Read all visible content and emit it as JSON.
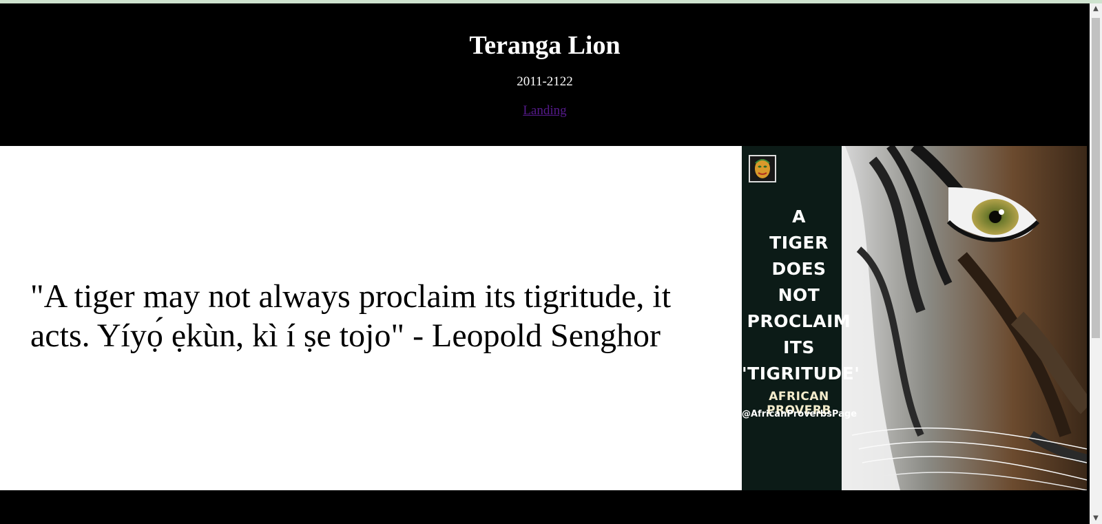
{
  "header": {
    "title": "Teranga Lion",
    "years": "2011-2122",
    "landing_link": "Landing"
  },
  "main": {
    "quote": "\"A tiger may not always proclaim its tigritude, it acts. Yíyọ́ ẹkùn, kì í ṣe tojo\" - Leopold Senghor"
  },
  "poster": {
    "lines": [
      "A",
      "TIGER",
      "DOES",
      "NOT",
      "PROCLAIM",
      "ITS",
      "'TIGRITUDE'"
    ],
    "subtitle": "AFRICAN PROVERB",
    "handle": "@AfricanProverbsPage",
    "badge_icon": "face-logo-icon"
  },
  "colors": {
    "background": "#000000",
    "text": "#ffffff",
    "link": "#551a8b",
    "panel": "#ffffff"
  }
}
